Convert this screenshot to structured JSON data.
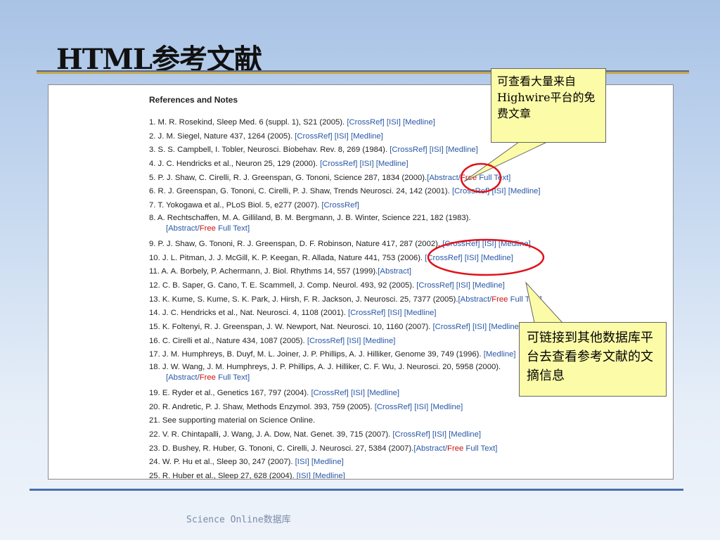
{
  "slide": {
    "title": "HTML参考文献",
    "footer": "Science Online数据库"
  },
  "document": {
    "heading": "References and Notes",
    "references": [
      {
        "text": "1. M. R. Rosekind, Sleep Med. 6 (suppl. 1), S21 (2005). ",
        "links": [
          "[CrossRef]",
          "[ISI]",
          "[Medline]"
        ]
      },
      {
        "text": "2. J. M. Siegel, Nature 437, 1264 (2005). ",
        "links": [
          "[CrossRef]",
          "[ISI]",
          "[Medline]"
        ]
      },
      {
        "text": "3. S. S. Campbell, I. Tobler, Neurosci. Biobehav. Rev. 8, 269 (1984). ",
        "links": [
          "[CrossRef]",
          "[ISI]",
          "[Medline]"
        ]
      },
      {
        "text": "4. J. C. Hendricks et al., Neuron 25, 129 (2000). ",
        "links": [
          "[CrossRef]",
          "[ISI]",
          "[Medline]"
        ]
      },
      {
        "text": "5. P. J. Shaw, C. Cirelli, R. J. Greenspan, G. Tononi, Science 287, 1834 (2000).",
        "links": [
          "[Abstract/",
          "Free",
          " Full Text]"
        ]
      },
      {
        "text": "6. R. J. Greenspan, G. Tononi, C. Cirelli, P. J. Shaw, Trends Neurosci. 24, 142 (2001). ",
        "links": [
          "[CrossRef]",
          "[ISI]",
          "[Medline]"
        ]
      },
      {
        "text": "7. T. Yokogawa et al., PLoS Biol. 5, e277 (2007). ",
        "links": [
          "[CrossRef]"
        ]
      },
      {
        "text": "8. A. Rechtschaffen, M. A. Gilliland, B. M. Bergmann, J. B. Winter, Science 221, 182 (1983).",
        "links": [
          "[Abstract/",
          "Free",
          " Full Text]"
        ],
        "wrap": true
      },
      {
        "text": "9. P. J. Shaw, G. Tononi, R. J. Greenspan, D. F. Robinson, Nature 417, 287 (2002). ",
        "links": [
          "[CrossRef]",
          "[ISI]",
          "[Medline]"
        ]
      },
      {
        "text": "10. J. L. Pitman, J. J. McGill, K. P. Keegan, R. Allada, Nature 441, 753 (2006). ",
        "links": [
          "[CrossRef]",
          "[ISI]",
          "[Medline]"
        ]
      },
      {
        "text": "11. A. A. Borbely, P. Achermann, J. Biol. Rhythms 14, 557 (1999).",
        "links": [
          "[Abstract]"
        ]
      },
      {
        "text": "12. C. B. Saper, G. Cano, T. E. Scammell, J. Comp. Neurol. 493, 92 (2005). ",
        "links": [
          "[CrossRef]",
          "[ISI]",
          "[Medline]"
        ]
      },
      {
        "text": "13. K. Kume, S. Kume, S. K. Park, J. Hirsh, F. R. Jackson, J. Neurosci. 25, 7377 (2005).",
        "links": [
          "[Abstract/",
          "Free",
          " Full Text]"
        ]
      },
      {
        "text": "14. J. C. Hendricks et al., Nat. Neurosci. 4, 1108 (2001). ",
        "links": [
          "[CrossRef]",
          "[ISI]",
          "[Medline]"
        ]
      },
      {
        "text": "15. K. Foltenyi, R. J. Greenspan, J. W. Newport, Nat. Neurosci. 10, 1160 (2007). ",
        "links": [
          "[CrossRef]",
          "[ISI]",
          "[Medline]"
        ]
      },
      {
        "text": "16. C. Cirelli et al., Nature 434, 1087 (2005). ",
        "links": [
          "[CrossRef]",
          "[ISI]",
          "[Medline]"
        ]
      },
      {
        "text": "17. J. M. Humphreys, B. Duyf, M. L. Joiner, J. P. Phillips, A. J. Hilliker, Genome 39, 749 (1996). ",
        "links": [
          "[Medline]"
        ]
      },
      {
        "text": "18. J. W. Wang, J. M. Humphreys, J. P. Phillips, A. J. Hilliker, C. F. Wu, J. Neurosci. 20, 5958 (2000).",
        "links": [
          "[Abstract/",
          "Free",
          " Full Text]"
        ],
        "wrap": true
      },
      {
        "text": "19. E. Ryder et al., Genetics 167, 797 (2004). ",
        "links": [
          "[CrossRef]",
          "[ISI]",
          "[Medline]"
        ]
      },
      {
        "text": "20. R. Andretic, P. J. Shaw, Methods Enzymol. 393, 759 (2005). ",
        "links": [
          "[CrossRef]",
          "[ISI]",
          "[Medline]"
        ]
      },
      {
        "text": "21. See supporting material on Science Online.",
        "links": []
      },
      {
        "text": "22. V. R. Chintapalli, J. Wang, J. A. Dow, Nat. Genet. 39, 715 (2007). ",
        "links": [
          "[CrossRef]",
          "[ISI]",
          "[Medline]"
        ]
      },
      {
        "text": "23. D. Bushey, R. Huber, G. Tononi, C. Cirelli, J. Neurosci. 27, 5384 (2007).",
        "links": [
          "[Abstract/",
          "Free",
          " Full Text]"
        ]
      },
      {
        "text": "24. W. P. Hu et al., Sleep 30, 247 (2007). ",
        "links": [
          "[ISI]",
          "[Medline]"
        ]
      },
      {
        "text": "25. R. Huber et al., Sleep 27, 628 (2004). ",
        "links": [
          "[ISI]",
          "[Medline]"
        ]
      }
    ]
  },
  "callouts": {
    "free_text": "可查看大量来自Highwire平台的免费文章",
    "abstract_links": "可链接到其他数据库平台去查看参考文献的文摘信息"
  },
  "colors": {
    "link": "#2a58a6",
    "free": "#cc1111",
    "callout_bg": "#fcfca8",
    "circle": "#e0121a"
  }
}
